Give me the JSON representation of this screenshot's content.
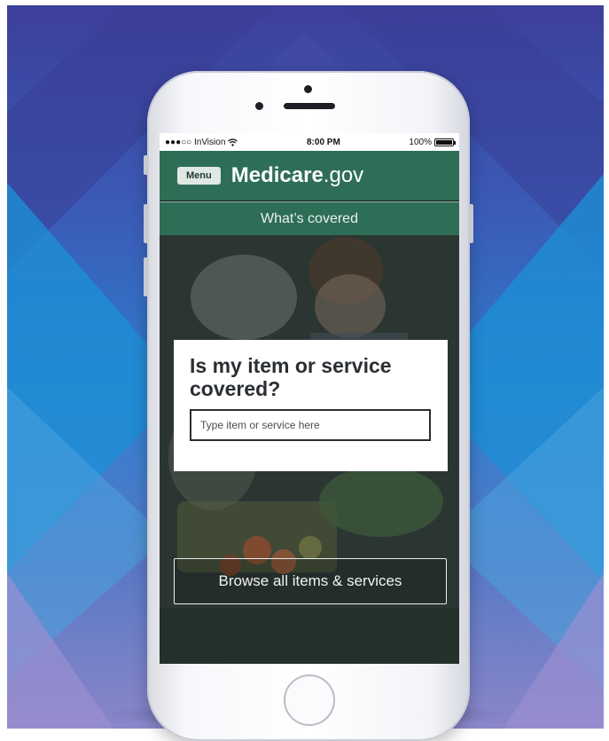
{
  "status_bar": {
    "carrier": "●●●○○ InVision",
    "time": "8:00 PM",
    "battery": "100%"
  },
  "header": {
    "menu_label": "Menu",
    "brand_bold": "Medicare",
    "brand_suffix": ".gov",
    "subnav_label": "What’s covered"
  },
  "main": {
    "card_title": "Is my item or service covered?",
    "search_placeholder": "Type item or service here",
    "browse_label": "Browse all items & services"
  },
  "colors": {
    "header_green": "#2e6e56",
    "background_blue": "#2f7fcf",
    "background_purple": "#3d3f9a"
  },
  "icons": {
    "wifi": "wifi-icon",
    "battery": "battery-icon"
  }
}
